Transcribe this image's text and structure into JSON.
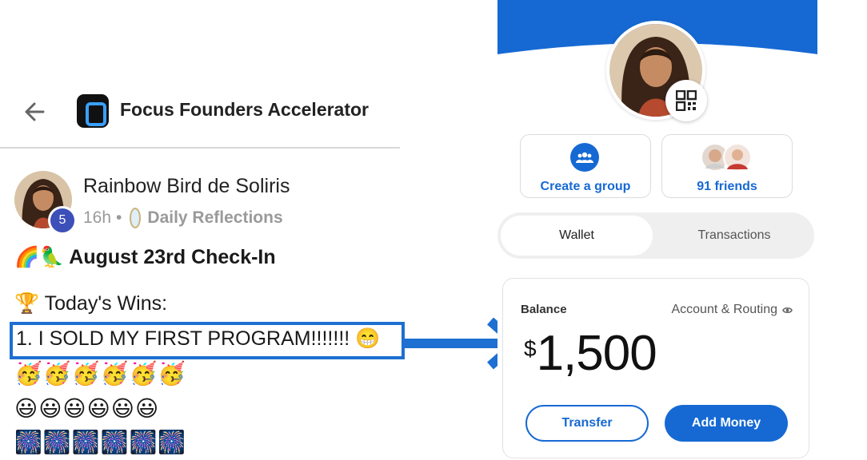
{
  "community_post": {
    "header": {
      "back_icon": "arrow-left-icon",
      "group_name": "Focus Founders Accelerator"
    },
    "post": {
      "author": "Rainbow Bird de Soliris",
      "level_badge": "5",
      "time_ago": "16h",
      "separator": "•",
      "topic": "Daily Reflections",
      "title": "🌈🦜 August 23rd Check-In",
      "wins_label": "🏆 Today's Wins:",
      "win_line": "1. I SOLD MY FIRST PROGRAM!!!!!!! 😁",
      "emoji_rows": [
        "🥳🥳🥳🥳🥳🥳",
        "😃😃😃😃😃😃",
        "🎆🎆🎆🎆🎆🎆"
      ]
    },
    "highlight_color": "#1d6fd1"
  },
  "wallet": {
    "accent_color": "#1669d3",
    "header_color": "#1669d3",
    "qr_icon": "qr-code-icon",
    "cards": {
      "create_group": {
        "label": "Create a group",
        "icon": "group-icon"
      },
      "friends": {
        "label": "91 friends",
        "icon": "friend-avatars"
      }
    },
    "tabs": [
      {
        "label": "Wallet",
        "active": true
      },
      {
        "label": "Transactions",
        "active": false
      }
    ],
    "balance": {
      "label": "Balance",
      "routing_label": "Account & Routing",
      "routing_icon": "eye-icon",
      "currency_symbol": "$",
      "amount": "1,500"
    },
    "buttons": {
      "transfer": "Transfer",
      "add_money": "Add Money"
    }
  }
}
